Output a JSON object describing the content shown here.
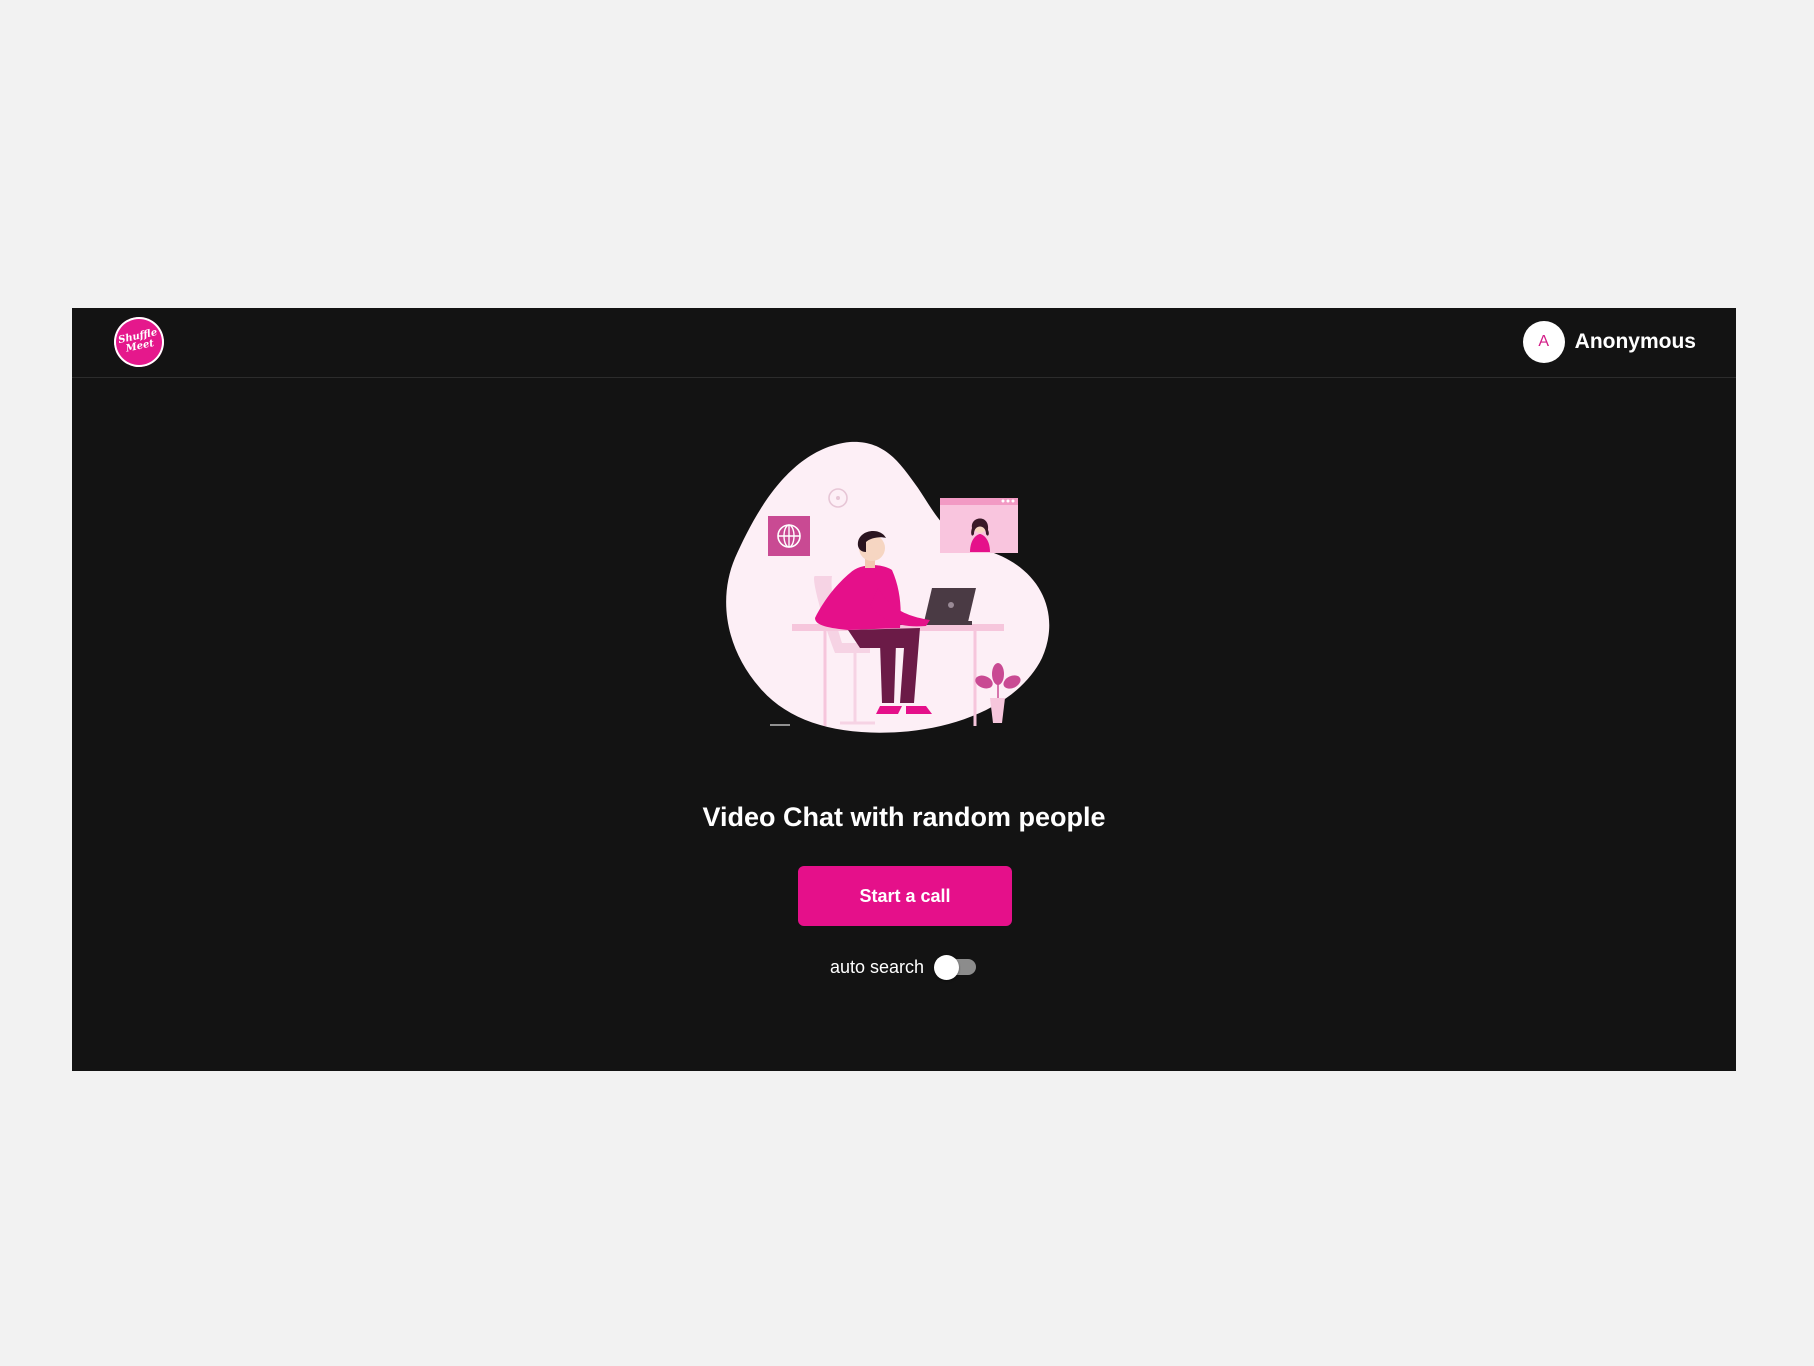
{
  "header": {
    "logo": {
      "line1": "Shuffle",
      "line2": "Meet"
    },
    "user": {
      "avatar_initial": "A",
      "name": "Anonymous"
    }
  },
  "hero": {
    "illustration": "person-on-video-call-illustration"
  },
  "main": {
    "title": "Video Chat with random people",
    "start_button": "Start a call",
    "auto_search": {
      "label": "auto search",
      "enabled": false
    }
  },
  "colors": {
    "accent": "#e5108a",
    "background": "#131313",
    "page": "#f2f2f2"
  }
}
